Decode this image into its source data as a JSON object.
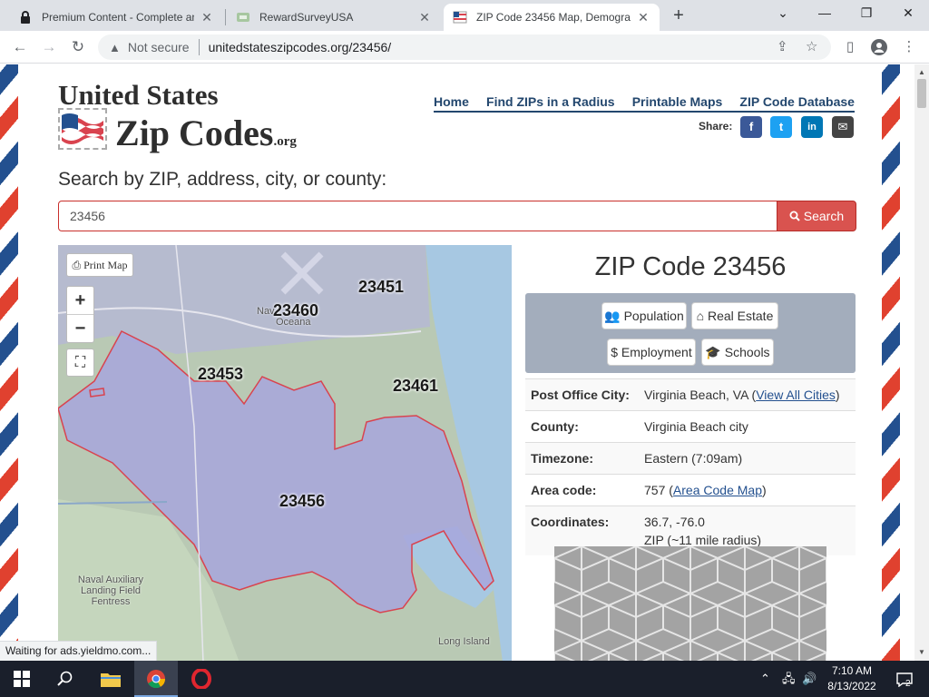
{
  "browser": {
    "tabs": [
      {
        "title": "Premium Content - Complete an",
        "close": "✕"
      },
      {
        "title": "RewardSurveyUSA",
        "close": "✕"
      },
      {
        "title": "ZIP Code 23456 Map, Demograp",
        "close": "✕"
      }
    ],
    "new_tab": "+",
    "window_controls": {
      "menu": "⌄",
      "minimize": "—",
      "restore": "❐",
      "close": "✕"
    },
    "nav": {
      "back": "←",
      "forward": "→",
      "reload": "↻"
    },
    "address": {
      "security_label": "Not secure",
      "url": "unitedstateszipcodes.org/23456/"
    }
  },
  "site": {
    "logo_line1": "United States",
    "logo_line2": "Zip Codes",
    "logo_suffix": ".org",
    "nav": [
      "Home",
      "Find ZIPs in a Radius",
      "Printable Maps",
      "ZIP Code Database"
    ],
    "share_label": "Share:",
    "share_buttons": [
      {
        "icon": "facebook-icon",
        "glyph": "f",
        "color": "#3b5998"
      },
      {
        "icon": "twitter-icon",
        "glyph": "t",
        "color": "#1da1f2"
      },
      {
        "icon": "linkedin-icon",
        "glyph": "in",
        "color": "#0077b5"
      },
      {
        "icon": "email-icon",
        "glyph": "✉",
        "color": "#444444"
      }
    ]
  },
  "search": {
    "label": "Search by ZIP, address, city, or county:",
    "value": "23456",
    "button_label": "Search"
  },
  "map": {
    "print_label": "Print Map",
    "zoom_in": "+",
    "zoom_out": "−",
    "fullscreen_glyph": "⛶",
    "zip_labels": [
      "23460",
      "23451",
      "23453",
      "23461",
      "23456"
    ],
    "place_labels": [
      "Nav",
      "Oceana",
      "Naval Auxiliary Landing Field Fentress",
      "Long Island"
    ],
    "highlight_color": "#d9434f"
  },
  "info": {
    "title": "ZIP Code 23456",
    "buttons": [
      {
        "icon": "users-icon",
        "label": "Population"
      },
      {
        "icon": "home-icon",
        "label": "Real Estate"
      },
      {
        "icon": "dollar-icon",
        "label": "$ Employment"
      },
      {
        "icon": "graduation-cap-icon",
        "label": "Schools"
      }
    ],
    "rows": {
      "post_office_city": {
        "key": "Post Office City:",
        "value": "Virginia Beach, VA (",
        "link": "View All Cities",
        "suffix": ")"
      },
      "county": {
        "key": "County:",
        "value": "Virginia Beach city"
      },
      "timezone": {
        "key": "Timezone:",
        "value": "Eastern (7:09am)"
      },
      "area_code": {
        "key": "Area code:",
        "value": "757 (",
        "link": "Area Code Map",
        "suffix": ")"
      },
      "coordinates": {
        "key": "Coordinates:",
        "value": "36.7, -76.0",
        "value2": "ZIP (~11 mile radius)"
      }
    }
  },
  "status_bar": "Waiting for ads.yieldmo.com...",
  "taskbar": {
    "time": "7:10 AM",
    "date": "8/13/2022",
    "notifications": "2"
  }
}
